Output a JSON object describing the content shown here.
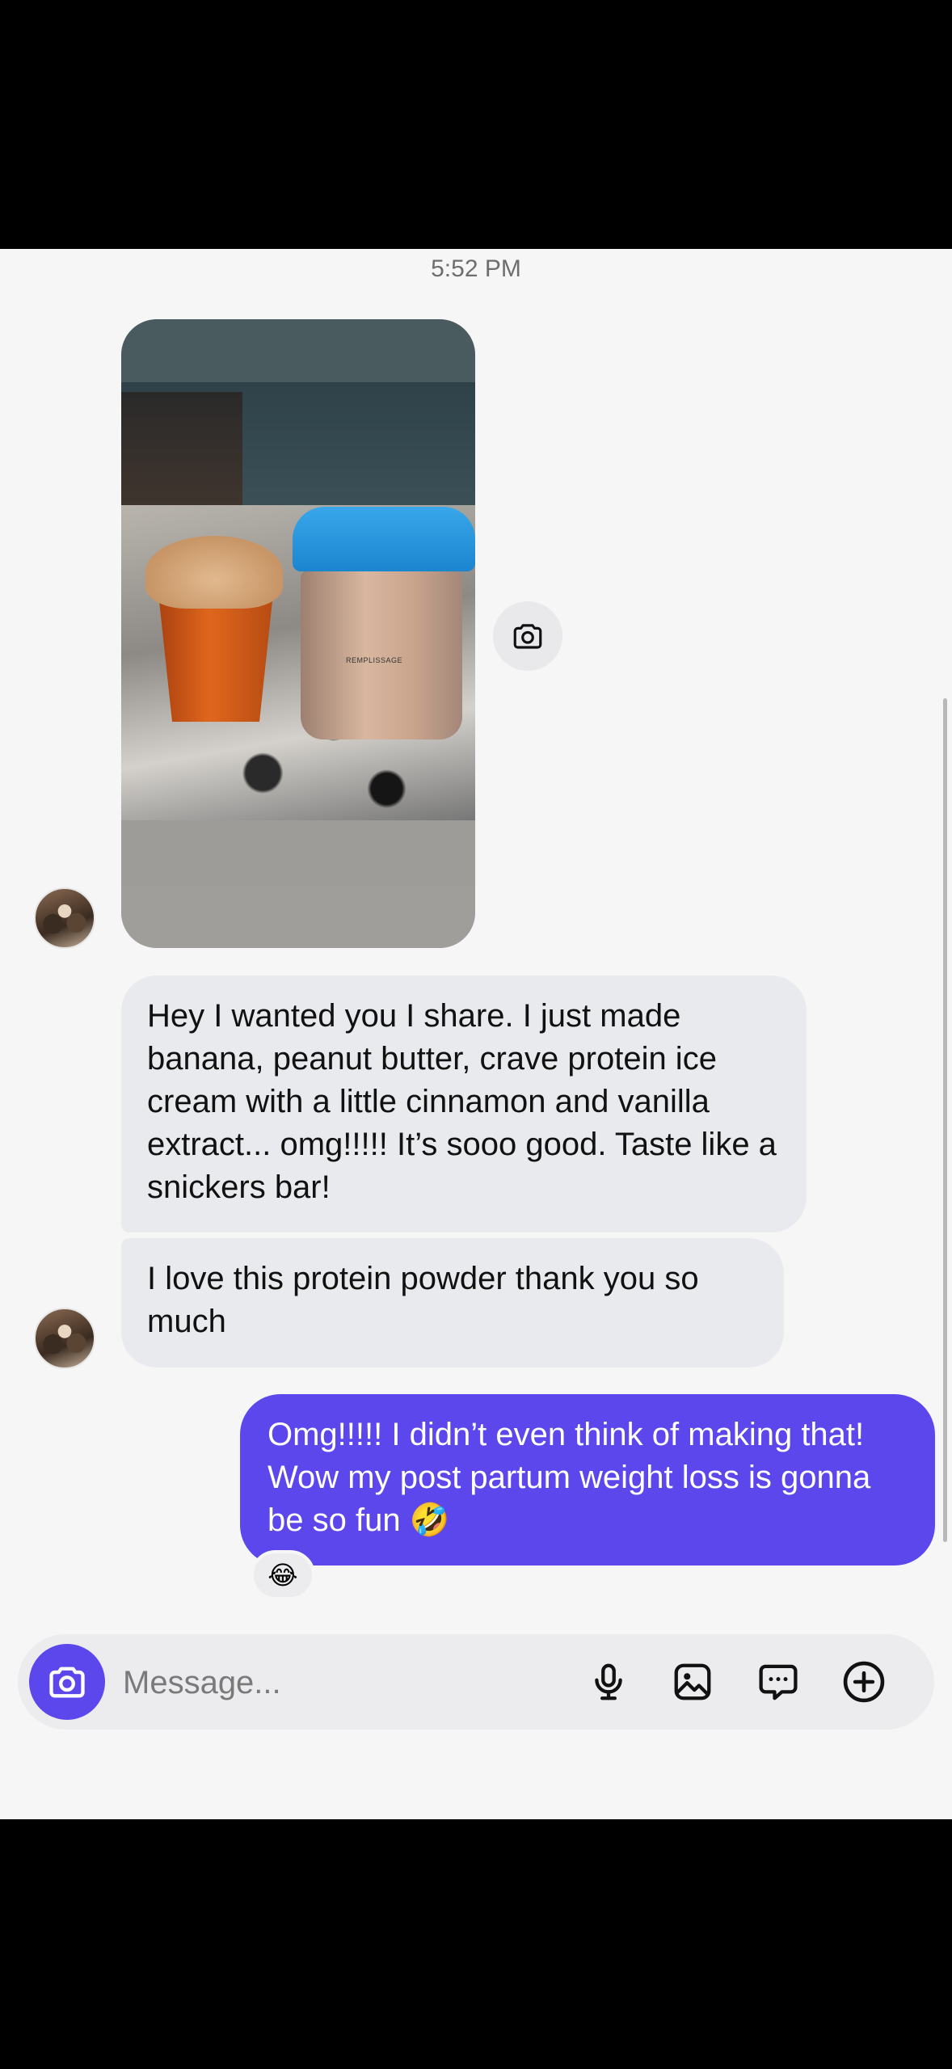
{
  "thread": {
    "timestamp": "5:52 PM"
  },
  "messages": {
    "incoming_1": "Hey I wanted you I share.  I just made banana, peanut butter, crave protein ice cream with a little cinnamon and vanilla extract... omg!!!!! It’s sooo good. Taste like a snickers bar!",
    "incoming_2": "I love this protein powder thank you so much",
    "outgoing_1": "Omg!!!!! I didn’t even think of making that! Wow my post partum weight loss is gonna be so fun 🤣",
    "reaction": "😂",
    "photo_jar_label": "REMPLISSAGE"
  },
  "composer": {
    "placeholder": "Message..."
  },
  "icons": {
    "photo_camera": "camera-icon",
    "composer_camera": "camera-icon",
    "mic": "microphone-icon",
    "gallery": "gallery-icon",
    "sticker": "chat-bubble-icon",
    "add": "plus-circle-icon"
  },
  "colors": {
    "accent": "#5b47ec",
    "incoming_bubble": "#e9eaed",
    "background": "#f6f6f6"
  }
}
